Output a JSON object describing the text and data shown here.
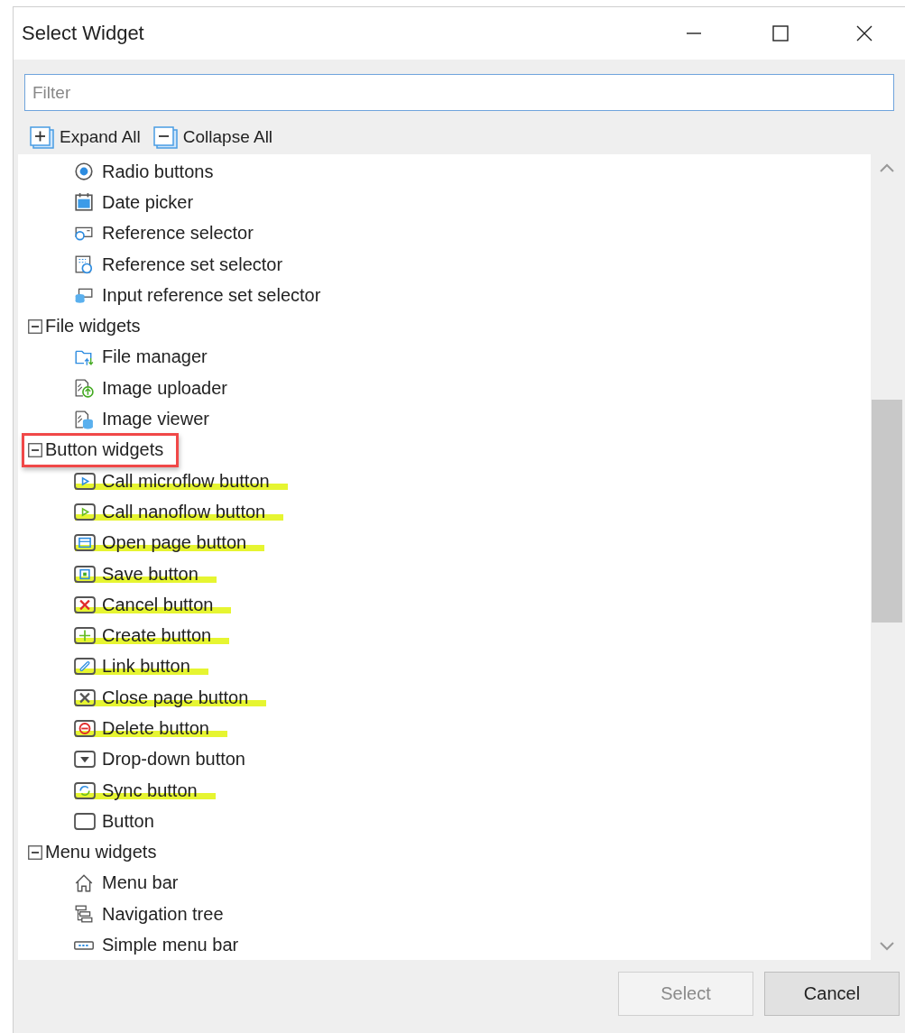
{
  "window": {
    "title": "Select Widget"
  },
  "filter": {
    "placeholder": "Filter"
  },
  "toolbar": [
    {
      "label": "Expand All",
      "kind": "expand"
    },
    {
      "label": "Collapse All",
      "kind": "collapse"
    }
  ],
  "tree": [
    {
      "kind": "item",
      "label": "Radio buttons",
      "highlighted": false
    },
    {
      "kind": "item",
      "label": "Date picker",
      "highlighted": false
    },
    {
      "kind": "item",
      "label": "Reference selector",
      "highlighted": false
    },
    {
      "kind": "item",
      "label": "Reference set selector",
      "highlighted": false
    },
    {
      "kind": "item",
      "label": "Input reference set selector",
      "highlighted": false
    },
    {
      "kind": "group",
      "label": "File widgets",
      "expanded": true,
      "outlined": false,
      "children": [
        {
          "label": "File manager",
          "highlighted": false
        },
        {
          "label": "Image uploader",
          "highlighted": false
        },
        {
          "label": "Image viewer",
          "highlighted": false
        }
      ]
    },
    {
      "kind": "group",
      "label": "Button widgets",
      "expanded": true,
      "outlined": true,
      "children": [
        {
          "label": "Call microflow button",
          "highlighted": true
        },
        {
          "label": "Call nanoflow button",
          "highlighted": true
        },
        {
          "label": "Open page button",
          "highlighted": true
        },
        {
          "label": "Save button",
          "highlighted": true
        },
        {
          "label": "Cancel button",
          "highlighted": true
        },
        {
          "label": "Create button",
          "highlighted": true
        },
        {
          "label": "Link button",
          "highlighted": true
        },
        {
          "label": "Close page button",
          "highlighted": true
        },
        {
          "label": "Delete button",
          "highlighted": true
        },
        {
          "label": "Drop-down button",
          "highlighted": false
        },
        {
          "label": "Sync button",
          "highlighted": true
        },
        {
          "label": "Button",
          "highlighted": false
        }
      ]
    },
    {
      "kind": "group",
      "label": "Menu widgets",
      "expanded": true,
      "outlined": false,
      "children": [
        {
          "label": "Menu bar",
          "highlighted": false
        },
        {
          "label": "Navigation tree",
          "highlighted": false
        },
        {
          "label": "Simple menu bar",
          "highlighted": false
        }
      ]
    }
  ],
  "buttons": [
    {
      "label": "Select",
      "disabled": true
    },
    {
      "label": "Cancel",
      "disabled": false
    }
  ]
}
